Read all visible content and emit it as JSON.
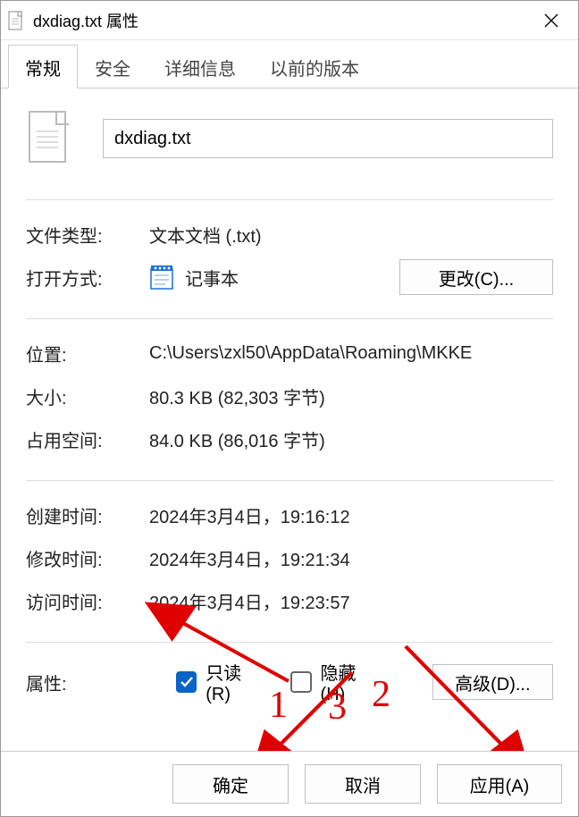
{
  "titlebar": {
    "title": "dxdiag.txt 属性"
  },
  "tabs": {
    "general": "常规",
    "security": "安全",
    "details": "详细信息",
    "previous": "以前的版本"
  },
  "general": {
    "filename": "dxdiag.txt",
    "type_label": "文件类型:",
    "type_value": "文本文档 (.txt)",
    "open_with_label": "打开方式:",
    "open_with_value": "记事本",
    "change_button": "更改(C)...",
    "location_label": "位置:",
    "location_value": "C:\\Users\\zxl50\\AppData\\Roaming\\MKKE",
    "size_label": "大小:",
    "size_value": "80.3 KB (82,303 字节)",
    "disk_label": "占用空间:",
    "disk_value": "84.0 KB (86,016 字节)",
    "created_label": "创建时间:",
    "created_value": "2024年3月4日，19:16:12",
    "modified_label": "修改时间:",
    "modified_value": "2024年3月4日，19:21:34",
    "accessed_label": "访问时间:",
    "accessed_value": "2024年3月4日，19:23:57",
    "attrs_label": "属性:",
    "readonly_label": "只读(R)",
    "hidden_label": "隐藏(H)",
    "readonly_checked": true,
    "hidden_checked": false,
    "advanced_button": "高级(D)..."
  },
  "buttons": {
    "ok": "确定",
    "cancel": "取消",
    "apply": "应用(A)"
  },
  "annotations": {
    "n1": "1",
    "n2": "2",
    "n3": "3"
  }
}
